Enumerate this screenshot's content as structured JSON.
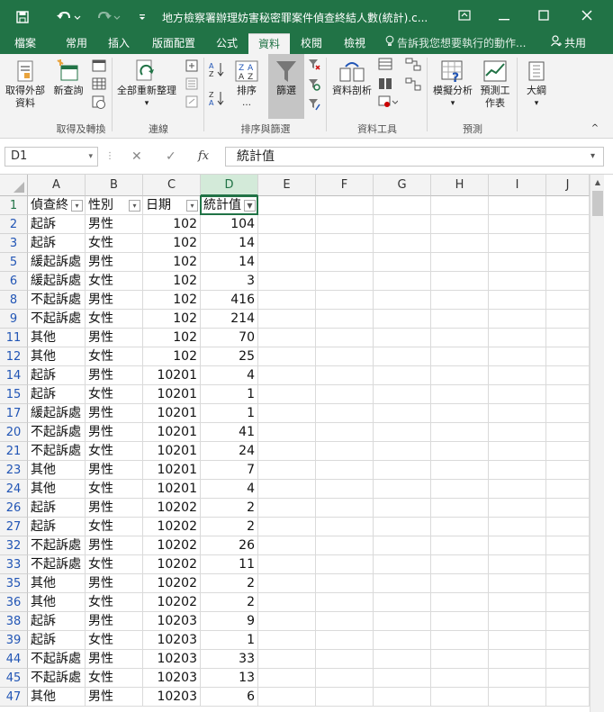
{
  "title_bar": {
    "title": "地方檢察署辦理妨害秘密罪案件偵查終結人數(統計).c...",
    "colors": {
      "excel_green": "#217346"
    }
  },
  "tabs": [
    {
      "label": "檔案"
    },
    {
      "label": "常用"
    },
    {
      "label": "插入"
    },
    {
      "label": "版面配置"
    },
    {
      "label": "公式"
    },
    {
      "label": "資料",
      "active": true
    },
    {
      "label": "校閱"
    },
    {
      "label": "檢視"
    }
  ],
  "tell_me": "告訴我您想要執行的動作...",
  "share": "共用",
  "ribbon": {
    "get_external": "取得外部資料",
    "new_query": "新查詢",
    "refresh_all": "全部重新整理",
    "sort": "排序",
    "filter": "篩選",
    "text_to_columns": "資料剖析",
    "what_if": "模擬分析",
    "forecast": "預測工作表",
    "outline": "大綱",
    "groups": {
      "get_transform": "取得及轉換",
      "connections": "連線",
      "sort_filter": "排序與篩選",
      "data_tools": "資料工具",
      "forecast": "預測"
    }
  },
  "formula_bar": {
    "name_box": "D1",
    "fx": "fx",
    "value": "統計值"
  },
  "columns": [
    "A",
    "B",
    "C",
    "D",
    "E",
    "F",
    "G",
    "H",
    "I",
    "J"
  ],
  "header_row": {
    "row": "1",
    "a": "偵查終",
    "b": "性別",
    "c": "日期",
    "d": "統計值"
  },
  "rows": [
    {
      "row": "2",
      "a": "起訴",
      "b": "男性",
      "c": "102",
      "d": "104"
    },
    {
      "row": "3",
      "a": "起訴",
      "b": "女性",
      "c": "102",
      "d": "14"
    },
    {
      "row": "5",
      "a": "緩起訴處",
      "b": "男性",
      "c": "102",
      "d": "14"
    },
    {
      "row": "6",
      "a": "緩起訴處",
      "b": "女性",
      "c": "102",
      "d": "3"
    },
    {
      "row": "8",
      "a": "不起訴處",
      "b": "男性",
      "c": "102",
      "d": "416"
    },
    {
      "row": "9",
      "a": "不起訴處",
      "b": "女性",
      "c": "102",
      "d": "214"
    },
    {
      "row": "11",
      "a": "其他",
      "b": "男性",
      "c": "102",
      "d": "70"
    },
    {
      "row": "12",
      "a": "其他",
      "b": "女性",
      "c": "102",
      "d": "25"
    },
    {
      "row": "14",
      "a": "起訴",
      "b": "男性",
      "c": "10201",
      "d": "4"
    },
    {
      "row": "15",
      "a": "起訴",
      "b": "女性",
      "c": "10201",
      "d": "1"
    },
    {
      "row": "17",
      "a": "緩起訴處",
      "b": "男性",
      "c": "10201",
      "d": "1"
    },
    {
      "row": "20",
      "a": "不起訴處",
      "b": "男性",
      "c": "10201",
      "d": "41"
    },
    {
      "row": "21",
      "a": "不起訴處",
      "b": "女性",
      "c": "10201",
      "d": "24"
    },
    {
      "row": "23",
      "a": "其他",
      "b": "男性",
      "c": "10201",
      "d": "7"
    },
    {
      "row": "24",
      "a": "其他",
      "b": "女性",
      "c": "10201",
      "d": "4"
    },
    {
      "row": "26",
      "a": "起訴",
      "b": "男性",
      "c": "10202",
      "d": "2"
    },
    {
      "row": "27",
      "a": "起訴",
      "b": "女性",
      "c": "10202",
      "d": "2"
    },
    {
      "row": "32",
      "a": "不起訴處",
      "b": "男性",
      "c": "10202",
      "d": "26"
    },
    {
      "row": "33",
      "a": "不起訴處",
      "b": "女性",
      "c": "10202",
      "d": "11"
    },
    {
      "row": "35",
      "a": "其他",
      "b": "男性",
      "c": "10202",
      "d": "2"
    },
    {
      "row": "36",
      "a": "其他",
      "b": "女性",
      "c": "10202",
      "d": "2"
    },
    {
      "row": "38",
      "a": "起訴",
      "b": "男性",
      "c": "10203",
      "d": "9"
    },
    {
      "row": "39",
      "a": "起訴",
      "b": "女性",
      "c": "10203",
      "d": "1"
    },
    {
      "row": "44",
      "a": "不起訴處",
      "b": "男性",
      "c": "10203",
      "d": "33"
    },
    {
      "row": "45",
      "a": "不起訴處",
      "b": "女性",
      "c": "10203",
      "d": "13"
    },
    {
      "row": "47",
      "a": "其他",
      "b": "男性",
      "c": "10203",
      "d": "6"
    }
  ]
}
